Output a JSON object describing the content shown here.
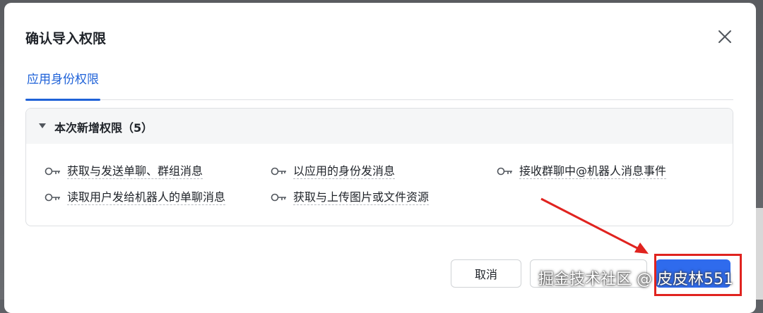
{
  "dialog": {
    "title": "确认导入权限",
    "close_icon": "close-icon"
  },
  "tabs": [
    {
      "label": "应用身份权限",
      "active": true
    }
  ],
  "panel": {
    "title": "本次新增权限（5）",
    "expanded": true,
    "items": [
      {
        "label": "获取与发送单聊、群组消息",
        "icon": "key-icon"
      },
      {
        "label": "以应用的身份发消息",
        "icon": "key-icon"
      },
      {
        "label": "接收群聊中@机器人消息事件",
        "icon": "key-icon"
      },
      {
        "label": "读取用户发给机器人的单聊消息",
        "icon": "key-icon"
      },
      {
        "label": "获取与上传图片或文件资源",
        "icon": "key-icon"
      }
    ]
  },
  "footer": {
    "cancel_label": "取消",
    "secondary_label": "",
    "primary_label": ""
  },
  "overlay": {
    "watermark": "掘金技术社区 @ 皮皮林551"
  },
  "colors": {
    "accent": "#2f6bed",
    "tab_active": "#1f62d8",
    "annotation": "#e0231f"
  }
}
